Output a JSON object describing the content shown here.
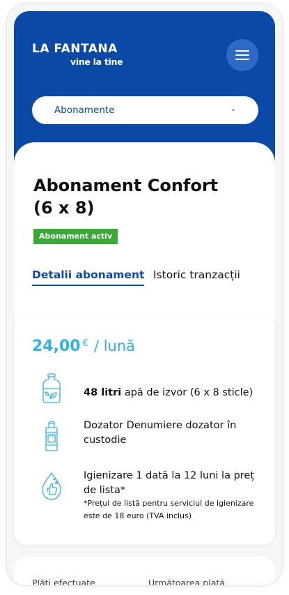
{
  "header": {
    "logo_main": "LA FANTANA",
    "logo_sub": "vine la tine",
    "select_value": "Abonamente"
  },
  "subscription": {
    "title_line1": "Abonament Confort",
    "title_line2": "(6 x 8)",
    "status_badge": "Abonament activ"
  },
  "tabs": [
    {
      "label": "Detalii abonament",
      "active": true
    },
    {
      "label": "Istoric tranzacții",
      "active": false
    }
  ],
  "pricing": {
    "value": "24,00",
    "currency": "€",
    "unit": "/ lună"
  },
  "features": [
    {
      "icon": "water-bottle-icon",
      "bold": "48 litri",
      "text": " apă de izvor (6 x 8 sticle)"
    },
    {
      "icon": "water-dispenser-icon",
      "text": "Dozator Denumiere dozator în custodie"
    },
    {
      "icon": "sanitize-hand-icon",
      "text": "Igienizare 1 dată la 12 luni la preț de lista*"
    }
  ],
  "note": "*Prețul de listă pentru serviciul de igienizare este de 18 euro (TVA inclus)",
  "bottom": {
    "left_label": "Plăți efectuate",
    "right_label": "Următoarea plată"
  },
  "colors": {
    "brand_blue": "#0a4aa6",
    "accent_cyan": "#2bb4ec",
    "badge_green": "#3ca836"
  }
}
